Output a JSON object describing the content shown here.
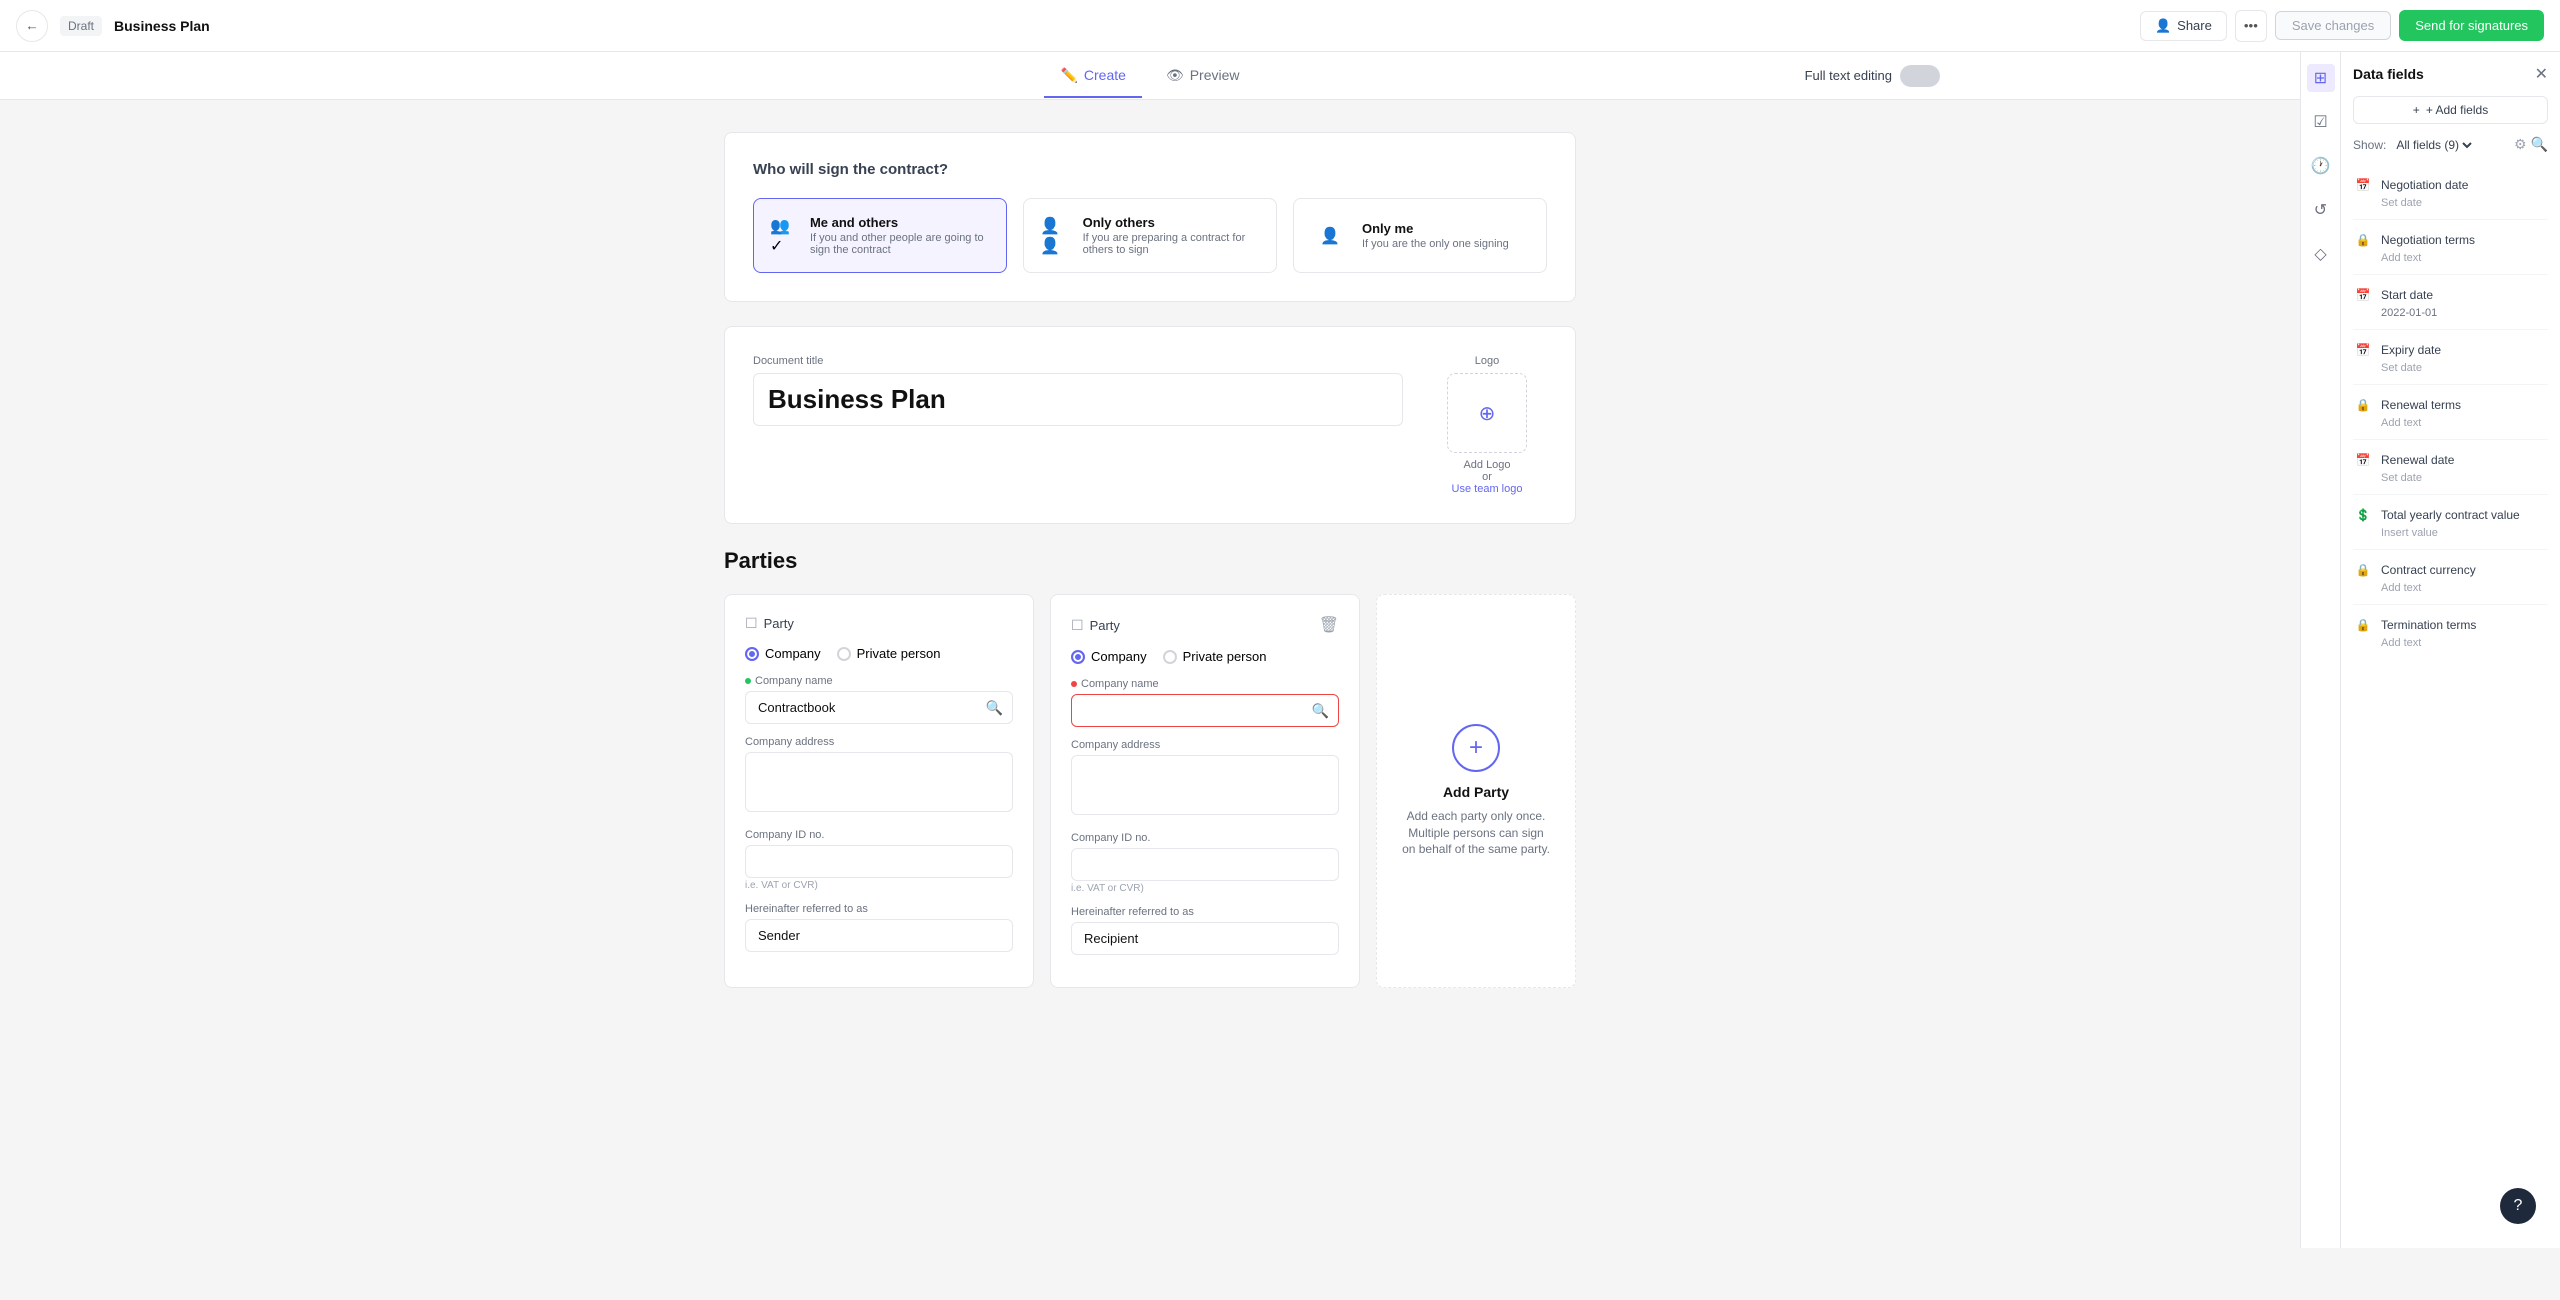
{
  "topbar": {
    "back_label": "←",
    "draft_label": "Draft",
    "doc_title": "Business Plan",
    "share_label": "Share",
    "more_label": "•••",
    "save_label": "Save changes",
    "send_label": "Send for signatures"
  },
  "tabs": {
    "create_label": "Create",
    "preview_label": "Preview",
    "full_text_label": "Full text editing"
  },
  "sign_section": {
    "title": "Who will sign the contract?",
    "options": [
      {
        "label": "Me and others",
        "desc": "If you and other people are going to sign the contract",
        "selected": true
      },
      {
        "label": "Only others",
        "desc": "If you are preparing a contract for others to sign",
        "selected": false
      },
      {
        "label": "Only me",
        "desc": "If you are the only one signing",
        "selected": false
      }
    ]
  },
  "document_section": {
    "title_label": "Document title",
    "title_value": "Business Plan",
    "logo_label": "Logo",
    "logo_add": "Add Logo",
    "logo_or": "or",
    "logo_team": "Use team logo"
  },
  "parties_section": {
    "title": "Parties",
    "party1": {
      "label": "Party",
      "type_company": "Company",
      "type_private": "Private person",
      "selected_type": "company",
      "company_name_label": "Company name",
      "company_name_value": "Contractbook",
      "company_address_label": "Company address",
      "company_id_label": "Company ID no.",
      "company_id_hint": "i.e. VAT or CVR)",
      "hereinafter_label": "Hereinafter referred to as",
      "hereinafter_value": "Sender"
    },
    "party2": {
      "label": "Party",
      "type_company": "Company",
      "type_private": "Private person",
      "selected_type": "company",
      "company_name_label": "Company name",
      "company_name_value": "",
      "company_address_label": "Company address",
      "company_id_label": "Company ID no.",
      "company_id_hint": "i.e. VAT or CVR)",
      "hereinafter_label": "Hereinafter referred to as",
      "hereinafter_value": "Recipient"
    },
    "add_party": {
      "label": "Add Party",
      "desc": "Add each party only once. Multiple persons can sign on behalf of the same party."
    }
  },
  "right_panel": {
    "title": "Data fields",
    "add_fields_label": "+ Add fields",
    "show_label": "Show:",
    "all_fields_label": "All fields (9)",
    "fields": [
      {
        "name": "Negotiation date",
        "value": "Set date",
        "has_value": false,
        "icon": "calendar"
      },
      {
        "name": "Negotiation terms",
        "value": "Add text",
        "has_value": false,
        "icon": "lock"
      },
      {
        "name": "Start date",
        "value": "2022-01-01",
        "has_value": true,
        "icon": "calendar"
      },
      {
        "name": "Expiry date",
        "value": "Set date",
        "has_value": false,
        "icon": "calendar"
      },
      {
        "name": "Renewal terms",
        "value": "Add text",
        "has_value": false,
        "icon": "lock"
      },
      {
        "name": "Renewal date",
        "value": "Set date",
        "has_value": false,
        "icon": "calendar"
      },
      {
        "name": "Total yearly contract value",
        "value": "Insert value",
        "has_value": false,
        "icon": "dollar"
      },
      {
        "name": "Contract currency",
        "value": "Add text",
        "has_value": false,
        "icon": "lock"
      },
      {
        "name": "Termination terms",
        "value": "Add text",
        "has_value": false,
        "icon": "lock"
      }
    ]
  }
}
